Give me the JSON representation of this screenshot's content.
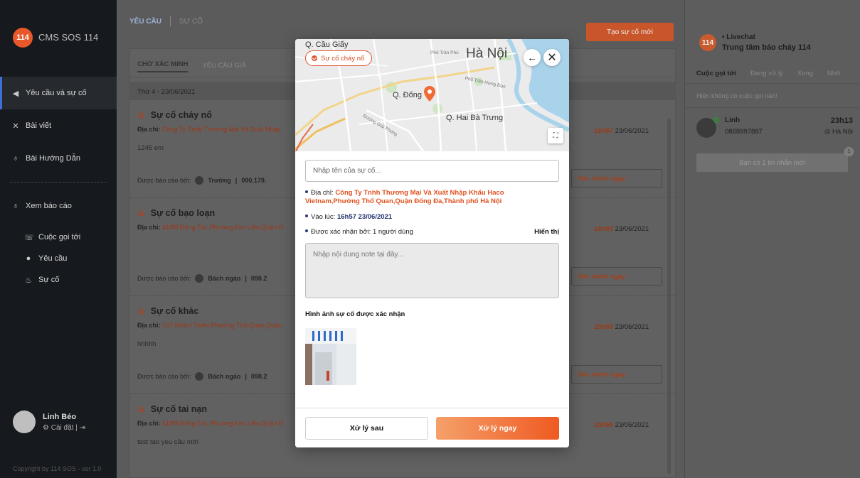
{
  "sidebar": {
    "logo": "114",
    "app_name": "CMS SOS 114",
    "items": [
      {
        "label": "Yêu cầu và sự cố",
        "icon": "megaphone-icon"
      },
      {
        "label": "Bài viết",
        "icon": "tools-icon"
      },
      {
        "label": "Bài Hướng Dẫn",
        "icon": "fire-extinguisher-icon"
      }
    ],
    "reports": {
      "label": "Xem báo cáo",
      "icon": "fire-extinguisher-icon"
    },
    "sub_items": [
      {
        "label": "Cuộc gọi tới",
        "icon": "phone-icon"
      },
      {
        "label": "Yêu cầu",
        "icon": "chat-icon"
      },
      {
        "label": "Sự cố",
        "icon": "fire-icon"
      }
    ],
    "user": {
      "name": "Linh Béo",
      "settings_label": "Cài đặt"
    },
    "copyright": "Copyright by 114 SOS - ver 1.0"
  },
  "main": {
    "top_tabs": [
      "YÊU CẦU",
      "SỰ CỐ"
    ],
    "create_button": "Tạo sự cố mới",
    "sub_tabs": [
      "CHỜ XÁC MINH",
      "YÊU CẦU GIẢ"
    ],
    "date_row": "Thứ 4 - 23/06/2021",
    "address_label": "Địa chỉ:",
    "reported_by_label": "Được báo cáo bởi:",
    "verify_label": "Xác minh ngay",
    "incidents": [
      {
        "title": "Sự cố cháy nổ",
        "address": "Công Ty Tnhh Thương Mại Và Xuất Nhập",
        "desc": "1245 em",
        "reporter": "Trường",
        "phone": "090.179.",
        "time": "16h57",
        "date": "23/06/2021"
      },
      {
        "title": "Sự cố bạo loạn",
        "address": "41/89 Đông Tác,Phường Kim Liên,Quận Đ",
        "desc": "",
        "reporter": "Bách ngáo",
        "phone": "098.2",
        "time": "16h03",
        "date": "23/06/2021"
      },
      {
        "title": "Sự cố khác",
        "address": "197 Khâm Thiên,Phường Thổ Quan,Quận",
        "desc": "hhhhh",
        "reporter": "Bách ngáo",
        "phone": "098.2",
        "time": "15h59",
        "date": "23/06/2021"
      },
      {
        "title": "Sự cố tai nạn",
        "address": "41/89 Đông Tác,Phường Kim Liên,Quận Đ",
        "desc": "test tao yeu cầu mới",
        "reporter": "",
        "phone": "",
        "time": "15h55",
        "date": "23/06/2021"
      }
    ]
  },
  "right": {
    "logo": "114",
    "status": "• Livechat",
    "title": "Trung tâm báo cháy 114",
    "tabs": [
      "Cuộc gọi tới",
      "Đang xử lý",
      "Xong",
      "Nhỡ"
    ],
    "empty_text": "Hiện không có cuộc gọi nào!",
    "call": {
      "name": "Linh",
      "phone": "0868997887",
      "time": "23h13",
      "location": "Hà Nội"
    },
    "message_text": "Bạn có 1 tin nhắn mới",
    "badge": "1"
  },
  "modal": {
    "map": {
      "labels": [
        "Q. Cầu Giấy",
        "Hà Nội",
        "Q. Đống",
        "Q. Hai Bà Trưng"
      ],
      "small_labels": [
        "Phố Trần Phú",
        "Phố Trần Hưng Đạo",
        "Đường Giải Phóng"
      ],
      "chip": "Sự cố cháy nổ"
    },
    "name_placeholder": "Nhập tên của sự cố...",
    "address_label": "Địa chỉ:",
    "address": "Công Ty Tnhh Thương Mại Và Xuất Nhập Khẩu Haco Vietnam,Phường Thổ Quan,Quận Đống Đa,Thành phố Hà Nội",
    "time_label": "Vào lúc:",
    "time": "16h57 23/06/2021",
    "confirmed_label": "Được xác nhận bởi: 1 người dùng",
    "show_label": "Hiển thị",
    "note_placeholder": "Nhập nội dung note tại đây...",
    "images_title": "Hình ảnh sự cố được xác nhận",
    "later_button": "Xử lý sau",
    "now_button": "Xử lý ngay"
  },
  "colors": {
    "accent": "#ef5a22",
    "sidebar": "#16191d",
    "link": "#24346e"
  }
}
